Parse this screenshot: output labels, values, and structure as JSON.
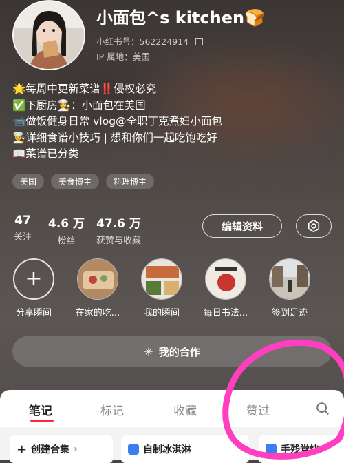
{
  "profile": {
    "name": "小面包^s kitchen🍞",
    "account_id": "小红书号：562224914",
    "ip_location": "IP 属地：美国"
  },
  "bio": [
    "🌟每周中更新菜谱‼️侵权必究",
    "✅下厨房👩‍🍳：小面包在美国",
    "📹做饭健身日常 vlog@全职丁克煮妇小面包",
    "👩‍🍳详细食谱小技巧 | 想和你们一起吃饱吃好",
    "📖菜谱已分类"
  ],
  "tags": [
    "美国",
    "美食博主",
    "料理博主"
  ],
  "stats": [
    {
      "value": "47",
      "label": "关注"
    },
    {
      "value": "4.6 万",
      "label": "粉丝"
    },
    {
      "value": "47.6 万",
      "label": "获赞与收藏"
    }
  ],
  "buttons": {
    "edit": "编辑资料"
  },
  "highlights": [
    {
      "label": "分享瞬间"
    },
    {
      "label": "在家的吃..."
    },
    {
      "label": "我的瞬间"
    },
    {
      "label": "每日书法..."
    },
    {
      "label": "签到足迹"
    }
  ],
  "cooperation": "我的合作",
  "tabs": [
    "笔记",
    "标记",
    "收藏",
    "赞过"
  ],
  "cards": [
    "创建合集",
    "自制冰淇淋",
    "手残党快"
  ],
  "colors": {
    "accent": "#ff2442",
    "annotation": "#ff3fbf"
  }
}
